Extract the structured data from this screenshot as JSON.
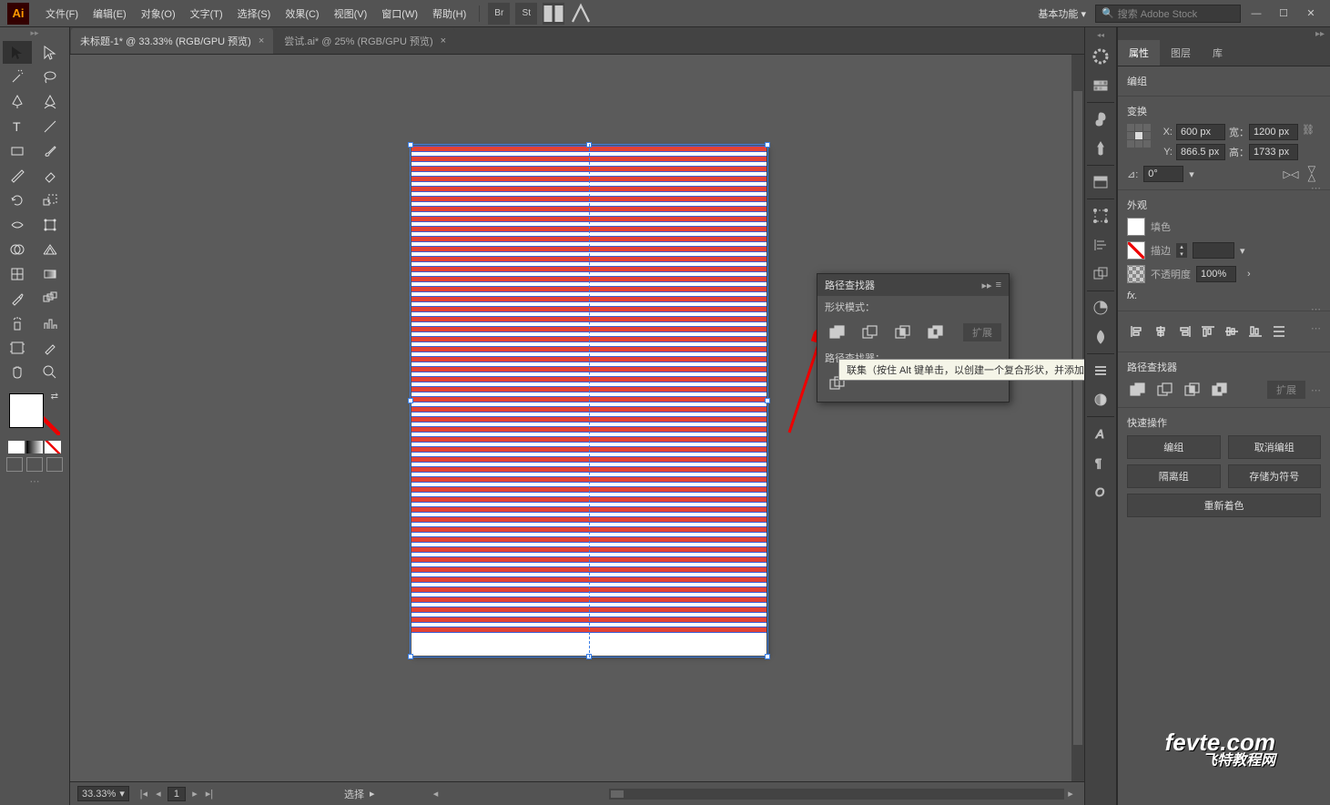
{
  "menubar": {
    "app_label": "Ai",
    "items": [
      "文件(F)",
      "编辑(E)",
      "对象(O)",
      "文字(T)",
      "选择(S)",
      "效果(C)",
      "视图(V)",
      "窗口(W)",
      "帮助(H)"
    ],
    "workspace": "基本功能",
    "search_placeholder": "搜索 Adobe Stock"
  },
  "tabs": [
    {
      "label": "未标题-1* @ 33.33% (RGB/GPU 预览)",
      "active": true
    },
    {
      "label": "尝试.ai* @ 25% (RGB/GPU 预览)",
      "active": false
    }
  ],
  "pathfinder": {
    "title": "路径查找器",
    "shape_modes_label": "形状模式：",
    "pathfinders_label": "路径查找器：",
    "expand_label": "扩展",
    "tooltip": "联集（按住 Alt 键单击，以创建一个复合形状，并添加到形状区域）"
  },
  "properties": {
    "tabs": [
      "属性",
      "图层",
      "库"
    ],
    "active_tab": 0,
    "selection_type": "编组",
    "transform": {
      "title": "变换",
      "x_label": "X:",
      "x_value": "600 px",
      "y_label": "Y:",
      "y_value": "866.5 px",
      "w_label": "宽：",
      "w_value": "1200 px",
      "h_label": "高：",
      "h_value": "1733 px",
      "angle_label": "⊿:",
      "angle_value": "0°"
    },
    "appearance": {
      "title": "外观",
      "fill_label": "填色",
      "stroke_label": "描边",
      "opacity_label": "不透明度",
      "opacity_value": "100%",
      "fx_label": "fx."
    },
    "pathfinder": {
      "title": "路径查找器",
      "expand": "扩展"
    },
    "quick_actions": {
      "title": "快速操作",
      "group": "编组",
      "ungroup": "取消编组",
      "isolate": "隔离组",
      "save_symbol": "存储为符号",
      "recolor": "重新着色"
    }
  },
  "statusbar": {
    "zoom": "33.33%",
    "artboard_num": "1",
    "tool_label": "选择"
  },
  "watermark": {
    "main": "fevte.com",
    "sub": "飞特教程网"
  }
}
